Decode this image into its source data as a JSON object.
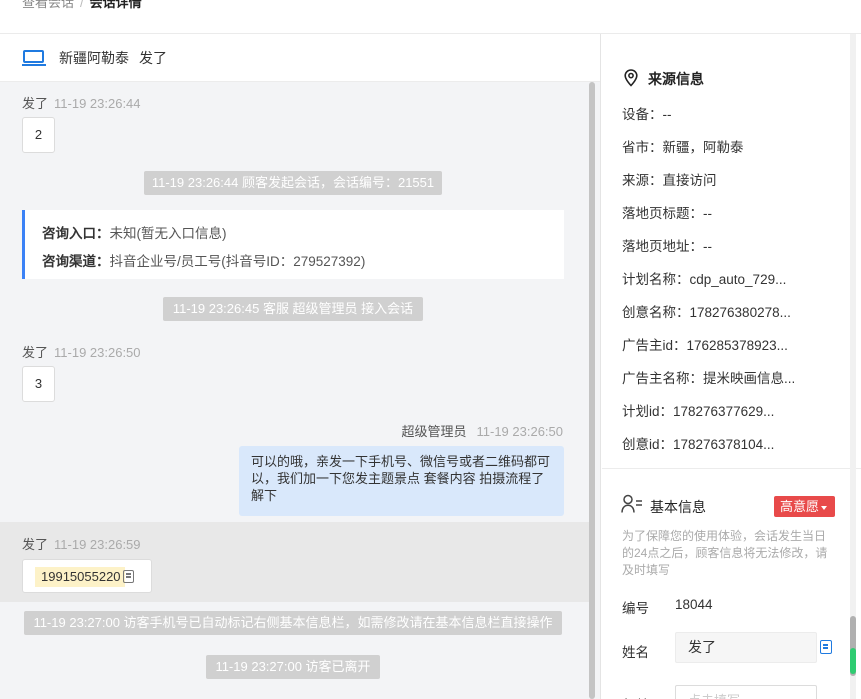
{
  "breadcrumb": {
    "parent": "查看会话",
    "separator": "/",
    "current": "会话详情"
  },
  "chat": {
    "header": {
      "region": "新疆阿勒泰",
      "visitor": "发了"
    },
    "messages": [
      {
        "sender": "发了",
        "time": "11-19 23:26:44",
        "content": "2"
      },
      {
        "sender": "发了",
        "time": "11-19 23:26:50",
        "content": "3"
      },
      {
        "sender": "发了",
        "time": "11-19 23:26:59",
        "content": "19915055220"
      }
    ],
    "notices": [
      "11-19 23:26:44 顾客发起会话，会话编号：21551",
      "11-19 23:26:45 客服 超级管理员 接入会话",
      "11-19 23:27:00 访客手机号已自动标记右侧基本信息栏，如需修改请在基本信息栏直接操作",
      "11-19 23:27:00 访客已离开"
    ],
    "entry_card": {
      "entry_label": "咨询入口：",
      "entry_value": "未知(暂无入口信息)",
      "channel_label": "咨询渠道：",
      "channel_value": "抖音企业号/员工号(抖音号ID：279527392)"
    },
    "agent_message": {
      "sender": "超级管理员",
      "time": "11-19 23:26:50",
      "content": "可以的哦，亲发一下手机号、微信号或者二维码都可以，我们加一下您发主题景点 套餐内容 拍摄流程了解下"
    }
  },
  "source_info": {
    "title": "来源信息",
    "items": [
      "设备：--",
      "省市：新疆，阿勒泰",
      "来源：直接访问",
      "落地页标题：--",
      "落地页地址：--",
      "计划名称：cdp_auto_729...",
      "创意名称：178276380278...",
      "广告主id：176285378923...",
      "广告主名称：提米映画信息...",
      "计划id：178276377629...",
      "创意id：178276378104..."
    ]
  },
  "basic_info": {
    "title": "基本信息",
    "intent_badge": "高意愿",
    "tip": "为了保障您的使用体验，会话发生当日的24点之后，顾客信息将无法修改，请及时填写",
    "id_label": "编号",
    "id_value": "18044",
    "name_label": "姓名",
    "name_value": "发了",
    "age_label": "年龄",
    "age_placeholder": "点击填写"
  },
  "icons": {
    "device": "laptop-icon",
    "location": "map-pin-icon",
    "user": "user-list-icon",
    "copy": "copy-icon"
  },
  "colors": {
    "accent": "#1f7ae0",
    "badge": "#e84a4a",
    "agent_bubble": "#d9e8fb",
    "notice": "#d0d0d0"
  }
}
